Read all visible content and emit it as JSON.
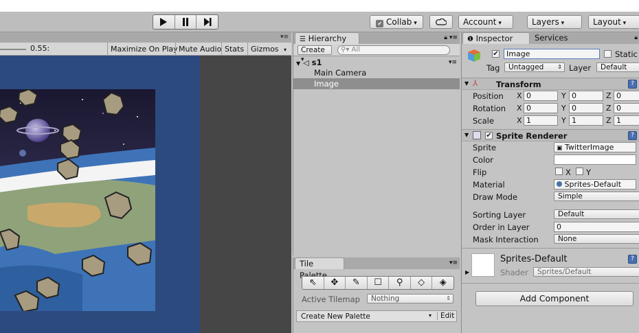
{
  "toolbar": {
    "collab": "Collab",
    "account": "Account",
    "layers": "Layers",
    "layout": "Layout"
  },
  "game": {
    "scale_value": "0.55:",
    "maximize_on_play": "Maximize On Play",
    "mute_audio": "Mute Audio",
    "stats": "Stats",
    "gizmos": "Gizmos"
  },
  "hierarchy": {
    "tab": "Hierarchy",
    "create": "Create",
    "search_placeholder": "All",
    "scene": "s1",
    "items": [
      "Main Camera",
      "Image"
    ]
  },
  "tile_palette": {
    "tab": "Tile Palette",
    "active_tilemap_label": "Active Tilemap",
    "active_tilemap_value": "Nothing",
    "create_new_palette": "Create New Palette",
    "edit": "Edit"
  },
  "inspector": {
    "tab": "Inspector",
    "services_tab": "Services",
    "object_name": "Image",
    "static": "Static",
    "tag_label": "Tag",
    "tag_value": "Untagged",
    "layer_label": "Layer",
    "layer_value": "Default",
    "transform": {
      "title": "Transform",
      "position_label": "Position",
      "rotation_label": "Rotation",
      "scale_label": "Scale",
      "position": [
        "0",
        "0",
        "0"
      ],
      "rotation": [
        "0",
        "0",
        "0"
      ],
      "scale": [
        "1",
        "1",
        "1"
      ],
      "axis": [
        "X",
        "Y",
        "Z"
      ]
    },
    "sprite_renderer": {
      "title": "Sprite Renderer",
      "sprite_label": "Sprite",
      "sprite_value": "TwitterImage",
      "color_label": "Color",
      "flip_label": "Flip",
      "flip_x": "X",
      "flip_y": "Y",
      "material_label": "Material",
      "material_value": "Sprites-Default",
      "draw_mode_label": "Draw Mode",
      "draw_mode_value": "Simple",
      "sorting_layer_label": "Sorting Layer",
      "sorting_layer_value": "Default",
      "order_in_layer_label": "Order in Layer",
      "order_in_layer_value": "0",
      "mask_interaction_label": "Mask Interaction",
      "mask_interaction_value": "None"
    },
    "material": {
      "name": "Sprites-Default",
      "shader_label": "Shader",
      "shader_value": "Sprites/Default"
    },
    "add_component": "Add Component"
  }
}
